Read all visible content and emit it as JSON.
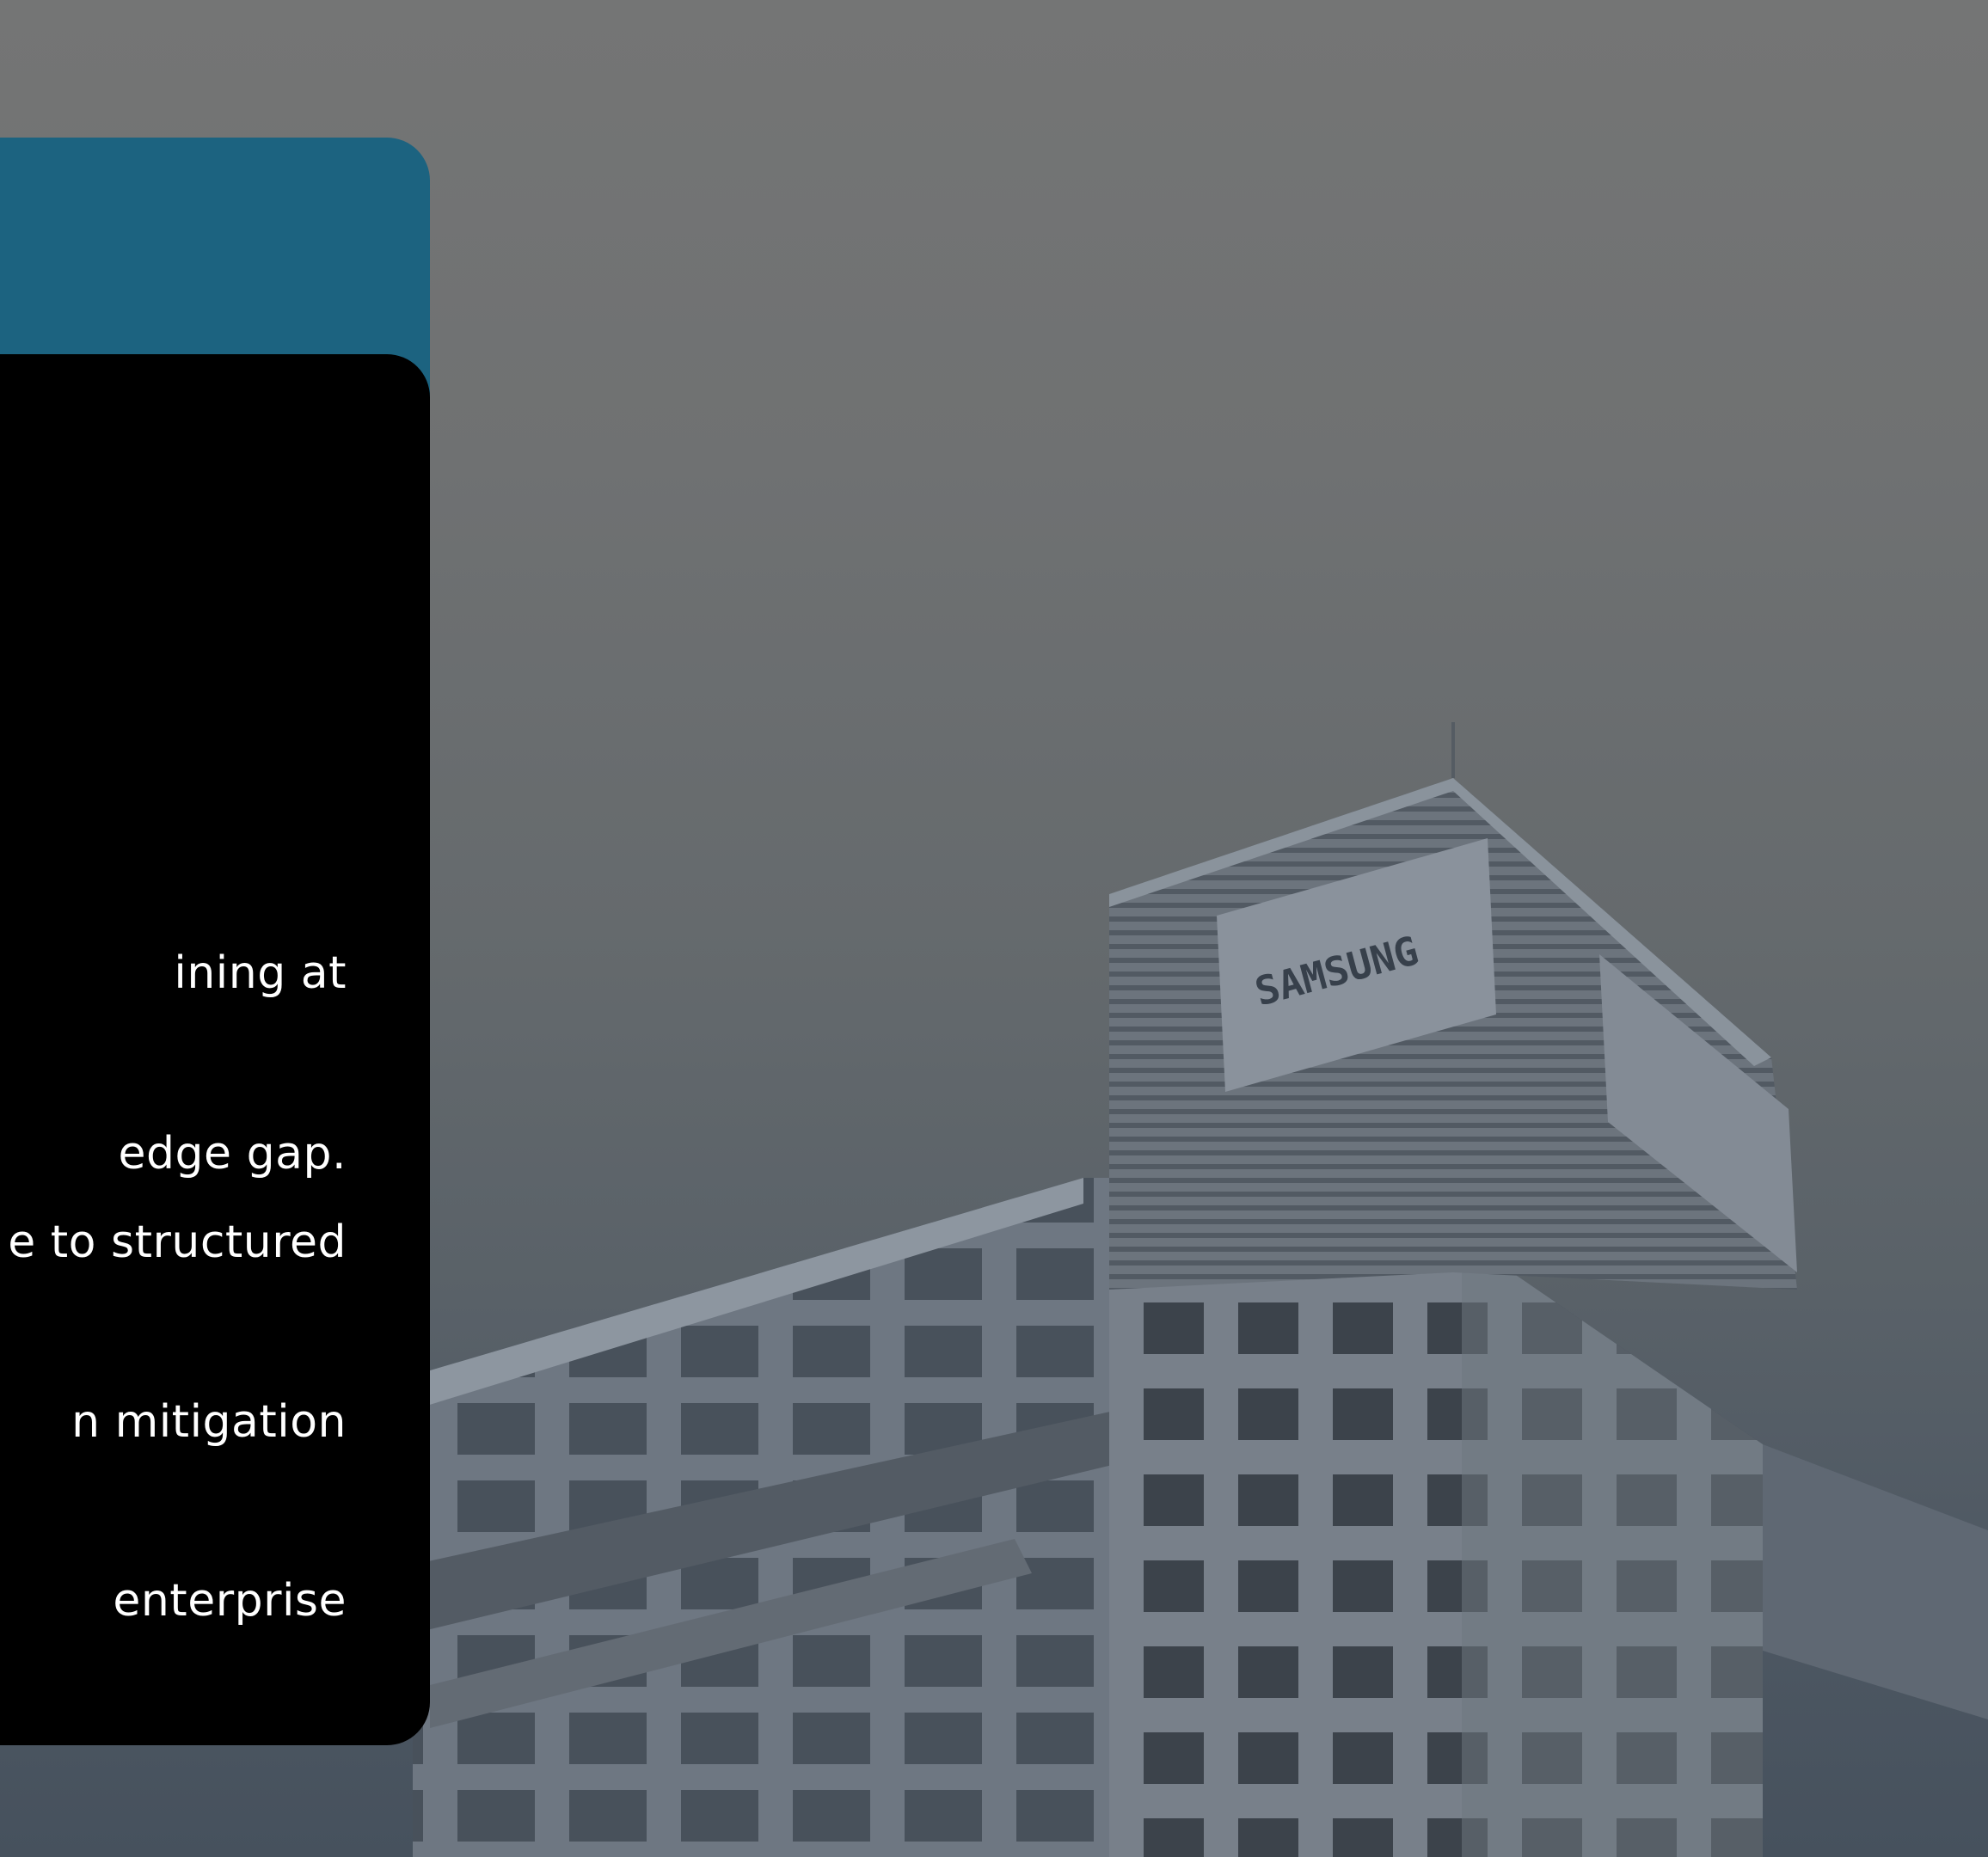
{
  "card": {
    "lines": [
      "ining at",
      "edge gap.",
      "e to structured",
      "n mitigation",
      "enterprise"
    ]
  },
  "image": {
    "sign_text": "SAMSUNG"
  },
  "colors": {
    "card_accent": "#1c6380",
    "card_body": "#000000",
    "text": "#ffffff",
    "sky": "#6f7172"
  }
}
